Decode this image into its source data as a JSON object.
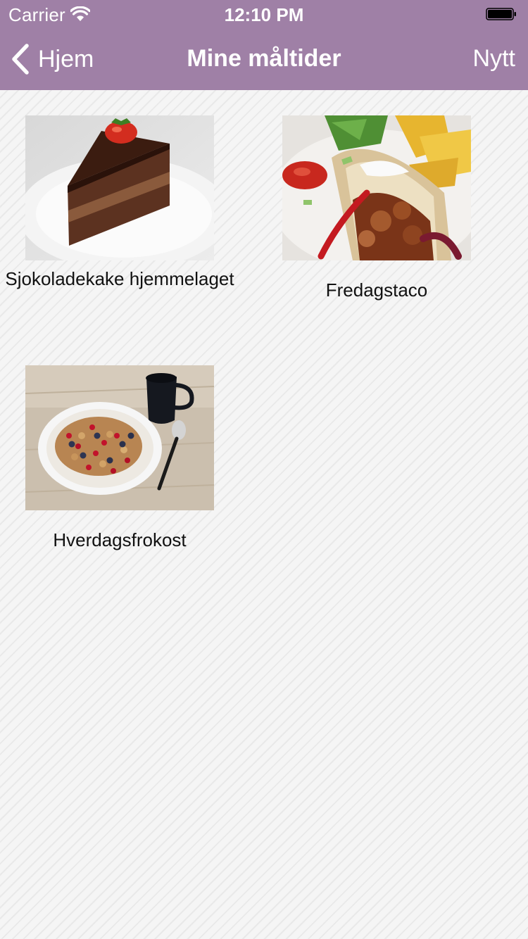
{
  "status_bar": {
    "carrier": "Carrier",
    "time": "12:10 PM",
    "icons": [
      "wifi-icon",
      "battery-icon"
    ]
  },
  "navbar": {
    "back_label": "Hjem",
    "title": "Mine måltider",
    "action_label": "Nytt",
    "background_color": "#9f80a6",
    "text_color": "#ffffff"
  },
  "meals": [
    {
      "name": "Sjokoladekake hjemmelaget",
      "photo": "chocolate-cake-photo"
    },
    {
      "name": "Fredagstaco",
      "photo": "taco-wrap-photo"
    },
    {
      "name": "Hverdagsfrokost",
      "photo": "breakfast-bowl-photo"
    }
  ]
}
